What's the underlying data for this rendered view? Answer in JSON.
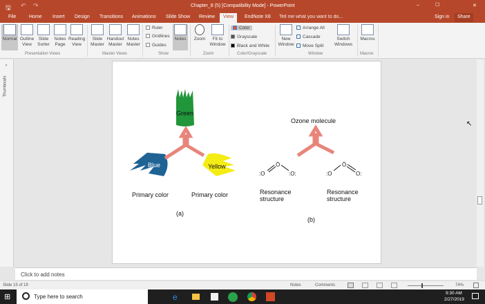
{
  "window": {
    "title": "Chapter_8 (5) [Compatibility Mode] - PowerPoint",
    "minimize": "–",
    "maximize": "☐",
    "close": "✕"
  },
  "tabs": [
    "File",
    "Home",
    "Insert",
    "Design",
    "Transitions",
    "Animations",
    "Slide Show",
    "Review",
    "View",
    "EndNote X8"
  ],
  "tell_me": "Tell me what you want to do...",
  "sign_in": "Sign in",
  "share": "Share",
  "ribbon": {
    "presentation_views": {
      "label": "Presentation Views",
      "buttons": [
        "Normal",
        "Outline View",
        "Slide Sorter",
        "Notes Page",
        "Reading View"
      ]
    },
    "master_views": {
      "label": "Master Views",
      "buttons": [
        "Slide Master",
        "Handout Master",
        "Notes Master"
      ]
    },
    "show": {
      "label": "Show",
      "checks": [
        "Ruler",
        "Gridlines",
        "Guides"
      ],
      "notes": "Notes"
    },
    "zoom": {
      "label": "Zoom",
      "buttons": [
        "Zoom",
        "Fit to Window"
      ]
    },
    "color": {
      "label": "Color/Grayscale",
      "options": [
        "Color",
        "Grayscale",
        "Black and White"
      ]
    },
    "window": {
      "label": "Window",
      "new_window": "New Window",
      "items": [
        "Arrange All",
        "Cascade",
        "Move Split"
      ],
      "switch": "Switch Windows"
    },
    "macros": {
      "label": "Macros",
      "button": "Macros"
    }
  },
  "thumbnails_label": "Thumbnails",
  "slide": {
    "green": "Green",
    "blue": "Blue",
    "yellow": "Yellow",
    "primary1": "Primary color",
    "primary2": "Primary color",
    "a": "(a)",
    "ozone": "Ozone molecule",
    "res1": "Resonance structure",
    "res2": "Resonance structure",
    "b": "(b)"
  },
  "notes_placeholder": "Click to add notes",
  "status": {
    "slide": "Slide 15 of 19",
    "notes": "Notes",
    "comments": "Comments",
    "zoom": "74%"
  },
  "taskbar": {
    "search": "Type here to search",
    "time": "9:30 AM",
    "date": "2/27/2019"
  }
}
